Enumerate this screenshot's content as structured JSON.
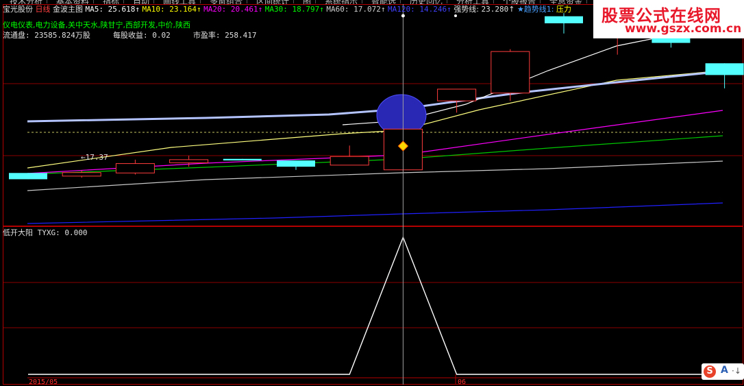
{
  "menu": {
    "items": [
      "技术分析",
      "基本资料",
      "指标",
      "自动",
      "画线工具",
      "多窗组合",
      "区间统计",
      "图",
      "系统指示",
      "智能选",
      "历史回忆",
      "分析工具",
      "个股报告",
      "全息资金"
    ]
  },
  "main_chart": {
    "stock_name": "宝光股份",
    "period": "日线",
    "indicator_name": "金波主图",
    "ma5": {
      "label": "MA5:",
      "value": "25.618",
      "color": "#ffffff"
    },
    "ma10": {
      "label": "MA10:",
      "value": "23.164",
      "color": "#ffff00"
    },
    "ma20": {
      "label": "MA20:",
      "value": "20.461",
      "color": "#ff00ff"
    },
    "ma30": {
      "label": "MA30:",
      "value": "18.797",
      "color": "#00ff00"
    },
    "ma60": {
      "label": "MA60:",
      "value": "17.072",
      "color": "#d0d0d0"
    },
    "ma120": {
      "label": "MA120:",
      "value": "14.246",
      "color": "#0000ff"
    },
    "strong_line": {
      "label": "强势线:",
      "value": "23.280"
    },
    "trend_line": {
      "label": "★趋势线1:"
    },
    "pressure_label": "压力",
    "concepts": "仪电仪表,电力设备,关中天水,陕甘宁,西部开发,中价,陕西",
    "float_shares": "流通盘: 23585.824万股",
    "eps": "每股收益: 0.02",
    "pe": "市盈率: 258.417",
    "low_price_marker": "←17.37"
  },
  "sub_chart": {
    "title": "低开大阳",
    "indicator": "TYXG:",
    "value": "0.000"
  },
  "time_axis": {
    "start_label": "2015/05",
    "mid_label": "06"
  },
  "logo": {
    "main": "股票公式在线网",
    "url": "www.gszx.com.cn"
  },
  "ime": {
    "label": "S"
  },
  "colors": {
    "up_candle": "#ff3c3c",
    "down_candle": "#54ffff",
    "grid": "#8b0000",
    "axis_red": "#b40000"
  },
  "chart_data": {
    "type": "candlestick",
    "candles": [
      {
        "open": 16.8,
        "close": 16.0,
        "high": 16.8,
        "low": 16.0
      },
      {
        "open": 16.4,
        "close": 16.85,
        "high": 17.1,
        "low": 16.2
      },
      {
        "open": 16.8,
        "close": 18.0,
        "high": 18.5,
        "low": 16.6
      },
      {
        "open": 18.1,
        "close": 18.5,
        "high": 19.0,
        "low": 17.6
      },
      {
        "open": 18.6,
        "close": 18.4,
        "high": 18.6,
        "low": 18.4
      },
      {
        "open": 18.4,
        "close": 17.6,
        "high": 18.4,
        "low": 17.2
      },
      {
        "open": 17.8,
        "close": 18.9,
        "high": 20.3,
        "low": 17.8
      },
      {
        "open": 17.2,
        "close": 22.4,
        "high": 22.6,
        "low": 17.0
      },
      {
        "open": 26.0,
        "close": 27.5,
        "high": 27.5,
        "low": 24.5
      },
      {
        "open": 27.0,
        "close": 32.3,
        "high": 32.6,
        "low": 26.0
      },
      {
        "open": 36.8,
        "close": 35.9,
        "high": 37.2,
        "low": 34.6
      },
      {
        "open": 35.0,
        "close": 37.0,
        "high": 38.2,
        "low": 31.9
      },
      {
        "open": 34.2,
        "close": 33.4,
        "high": 34.2,
        "low": 32.8
      },
      {
        "open": 30.8,
        "close": 29.3,
        "high": 30.8,
        "low": 27.6
      }
    ],
    "signal": [
      0,
      0,
      0,
      0,
      0,
      0,
      0,
      1,
      0,
      0,
      0,
      0,
      0,
      0
    ],
    "ylim": [
      10,
      38
    ]
  }
}
